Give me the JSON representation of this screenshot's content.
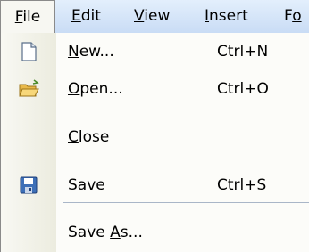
{
  "menubar": {
    "file": {
      "pre": "",
      "key": "F",
      "post": "ile"
    },
    "edit": {
      "pre": "",
      "key": "E",
      "post": "dit"
    },
    "view": {
      "pre": "",
      "key": "V",
      "post": "iew"
    },
    "insert": {
      "pre": "",
      "key": "I",
      "post": "nsert"
    },
    "format": {
      "pre": "F",
      "key": "o",
      "post": ""
    }
  },
  "file_menu": {
    "new": {
      "pre": "",
      "key": "N",
      "post": "ew...",
      "shortcut": "Ctrl+N",
      "icon": "new-document-icon"
    },
    "open": {
      "pre": "",
      "key": "O",
      "post": "pen...",
      "shortcut": "Ctrl+O",
      "icon": "open-folder-icon"
    },
    "close": {
      "pre": "",
      "key": "C",
      "post": "lose"
    },
    "save": {
      "pre": "",
      "key": "S",
      "post": "ave",
      "shortcut": "Ctrl+S",
      "icon": "save-disk-icon"
    },
    "save_as": {
      "pre": "Save ",
      "key": "A",
      "post": "s..."
    }
  }
}
